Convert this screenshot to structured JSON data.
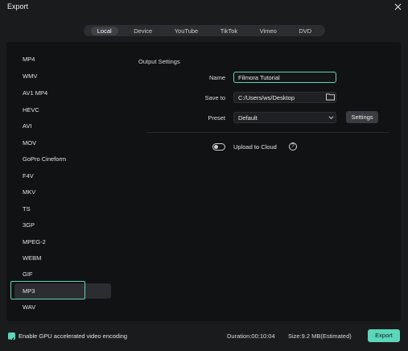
{
  "window": {
    "title": "Export"
  },
  "tabs": [
    {
      "label": "Local",
      "active": true
    },
    {
      "label": "Device",
      "active": false
    },
    {
      "label": "YouTube",
      "active": false
    },
    {
      "label": "TikTok",
      "active": false
    },
    {
      "label": "Vimeo",
      "active": false
    },
    {
      "label": "DVD",
      "active": false
    }
  ],
  "formats": {
    "items": [
      "MP4",
      "WMV",
      "AV1 MP4",
      "HEVC",
      "AVI",
      "MOV",
      "GoPro Cineform",
      "F4V",
      "MKV",
      "TS",
      "3GP",
      "MPEG-2",
      "WEBM",
      "GIF",
      "MP3",
      "WAV"
    ],
    "selected": "MP3"
  },
  "output": {
    "heading": "Output Settings",
    "name_label": "Name",
    "name_value": "Filmora Tutorial",
    "save_label": "Save to",
    "save_value": "C:/Users/ws/Desktop",
    "preset_label": "Preset",
    "preset_value": "Default",
    "settings_button": "Settings",
    "cloud_label": "Upload to Cloud",
    "cloud_enabled": false,
    "help_glyph": "?"
  },
  "footer": {
    "gpu_label": "Enable GPU accelerated video encoding",
    "gpu_checked": true,
    "duration": "Duration:00:10:04",
    "size": "Size:9.2 MB(Estimated)",
    "export_button": "Export"
  },
  "colors": {
    "accent": "#5cd6b9",
    "background": "#1a1b1d",
    "panel": "#111214"
  }
}
